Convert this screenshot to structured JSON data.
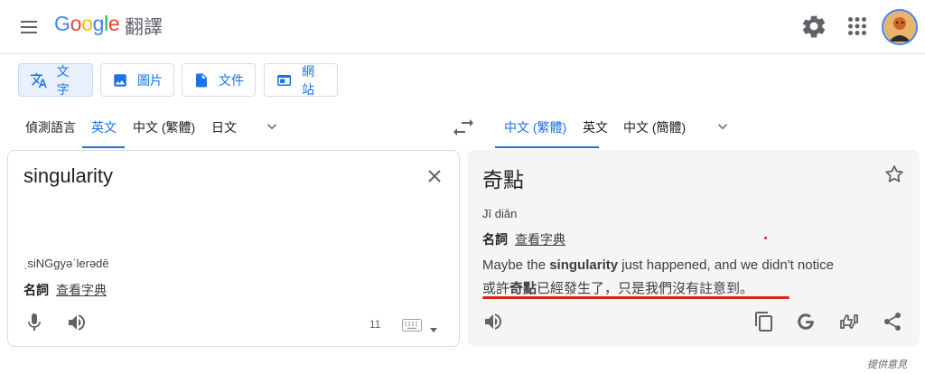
{
  "header": {
    "logo_text": "Google",
    "app_name": "翻譯"
  },
  "modes": [
    {
      "label": "文字",
      "icon": "translate-icon",
      "active": true
    },
    {
      "label": "圖片",
      "icon": "image-icon",
      "active": false
    },
    {
      "label": "文件",
      "icon": "document-icon",
      "active": false
    },
    {
      "label": "網站",
      "icon": "website-icon",
      "active": false
    }
  ],
  "source_langs": [
    "偵測語言",
    "英文",
    "中文 (繁體)",
    "日文"
  ],
  "target_langs": [
    "中文 (繁體)",
    "英文",
    "中文 (簡體)"
  ],
  "source": {
    "text": "singularity",
    "phonetic": "ˌsiNGgyəˈlerədē",
    "pos": "名詞",
    "dict_link": "查看字典",
    "char_count": "11"
  },
  "target": {
    "text": "奇點",
    "romanization": "Jī diǎn",
    "pos": "名詞",
    "dict_link": "查看字典",
    "example_en_before": "Maybe the ",
    "example_en_bold": "singularity",
    "example_en_after": " just happened, and we didn't notice",
    "example_zh_before": "或許",
    "example_zh_bold": "奇點",
    "example_zh_after": "已經發生了，只是我們沒有註意到。"
  },
  "footer": {
    "feedback": "提供意見"
  },
  "colors": {
    "accent": "#1a73e8",
    "annotation_red": "#e0201b",
    "target_bg": "#f5f5f5"
  }
}
